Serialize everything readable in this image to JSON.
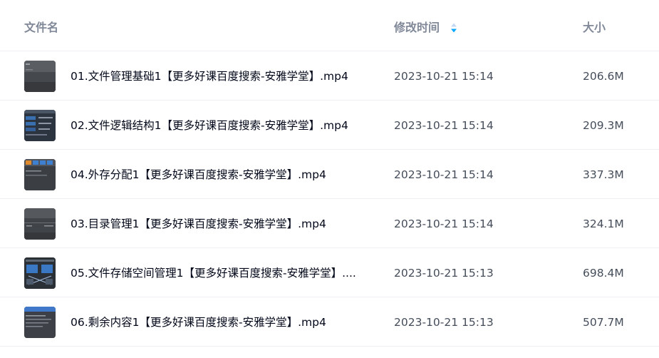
{
  "header": {
    "name_label": "文件名",
    "time_label": "修改时间",
    "size_label": "大小",
    "sort_icon": "sort-caret-icon"
  },
  "colors": {
    "sort_active": "#06a7ff",
    "sort_inactive": "#c4d8f4",
    "header_text": "#818999",
    "name_text": "#03081a",
    "meta_text": "#454d5a"
  },
  "files": [
    {
      "name": "01.文件管理基础1【更多好课百度搜索-安雅学堂】.mp4",
      "time": "2023-10-21 15:14",
      "size": "206.6M",
      "thumb_icon": "video-thumbnail-icon"
    },
    {
      "name": "02.文件逻辑结构1【更多好课百度搜索-安雅学堂】.mp4",
      "time": "2023-10-21 15:14",
      "size": "209.3M",
      "thumb_icon": "video-thumbnail-icon"
    },
    {
      "name": "04.外存分配1【更多好课百度搜索-安雅学堂】.mp4",
      "time": "2023-10-21 15:14",
      "size": "337.3M",
      "thumb_icon": "video-thumbnail-icon"
    },
    {
      "name": "03.目录管理1【更多好课百度搜索-安雅学堂】.mp4",
      "time": "2023-10-21 15:14",
      "size": "324.1M",
      "thumb_icon": "video-thumbnail-icon"
    },
    {
      "name": "05.文件存储空间管理1【更多好课百度搜索-安雅学堂】....",
      "time": "2023-10-21 15:13",
      "size": "698.4M",
      "thumb_icon": "video-thumbnail-icon"
    },
    {
      "name": "06.剩余内容1【更多好课百度搜索-安雅学堂】.mp4",
      "time": "2023-10-21 15:13",
      "size": "507.7M",
      "thumb_icon": "video-thumbnail-icon"
    }
  ]
}
